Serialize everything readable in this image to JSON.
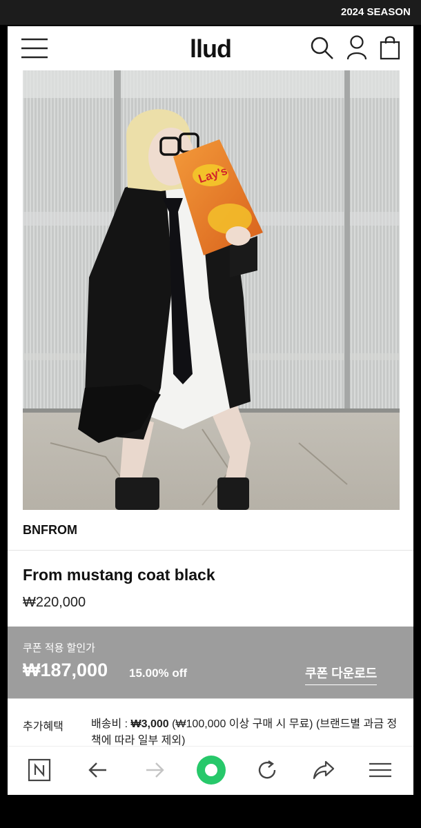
{
  "status_bar": {
    "marquee": "2024 SEASON"
  },
  "header": {
    "logo": "llud",
    "icons": [
      "menu-icon",
      "search-icon",
      "user-icon",
      "shopping-bag-icon"
    ]
  },
  "product": {
    "brand": "BNFROM",
    "name": "From mustang coat black",
    "price": "₩220,000",
    "photo_chip_text": "Lay's"
  },
  "coupon": {
    "label": "쿠폰 적용 할인가",
    "price": "₩187,000",
    "discount": "15.00% off",
    "download_label": "쿠폰 다운로드"
  },
  "benefit": {
    "label": "추가혜택",
    "shipping_label": "배송비 : ",
    "shipping_fee": "₩3,000",
    "shipping_note": " (₩100,000 이상 구매 시 무료) (브랜드별 과금 정책에 따라 일부 제외)"
  },
  "bottom_nav": {
    "icons": [
      "naver-n-icon",
      "back-arrow-icon",
      "forward-arrow-icon",
      "home-circle-icon",
      "refresh-icon",
      "share-icon",
      "hamburger-icon"
    ]
  },
  "colors": {
    "coupon_bg": "#9d9d9d",
    "green_accent": "#27c86a",
    "topbar": "#1c1c1c"
  }
}
